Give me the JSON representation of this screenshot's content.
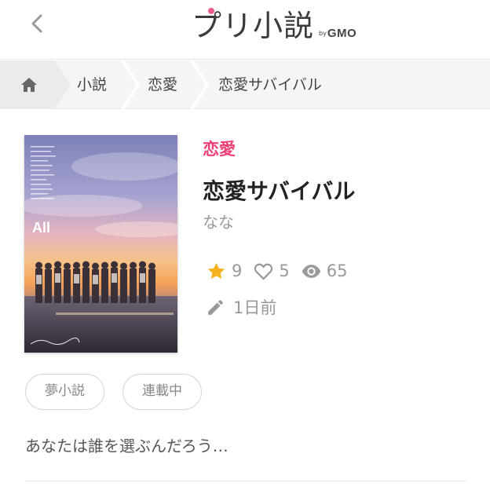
{
  "header": {
    "back_icon": "chevron-left-icon",
    "logo_main": "プリ小説",
    "logo_by": "by",
    "logo_gmo": "GMO"
  },
  "breadcrumb": {
    "home_icon": "home-icon",
    "items": [
      {
        "label": "小説"
      },
      {
        "label": "恋愛"
      },
      {
        "label": "恋愛サバイバル"
      }
    ]
  },
  "cover": {
    "overlay_text": "All"
  },
  "novel": {
    "genre": "恋愛",
    "title": "恋愛サバイバル",
    "author": "なな",
    "stars": "9",
    "likes": "5",
    "views": "65",
    "updated": "1日前",
    "tags": [
      "夢小説",
      "連載中"
    ],
    "synopsis": "あなたは誰を選ぶんだろう…"
  },
  "colors": {
    "accent": "#ee3f75",
    "star": "#f5b21d",
    "muted": "#999999"
  }
}
